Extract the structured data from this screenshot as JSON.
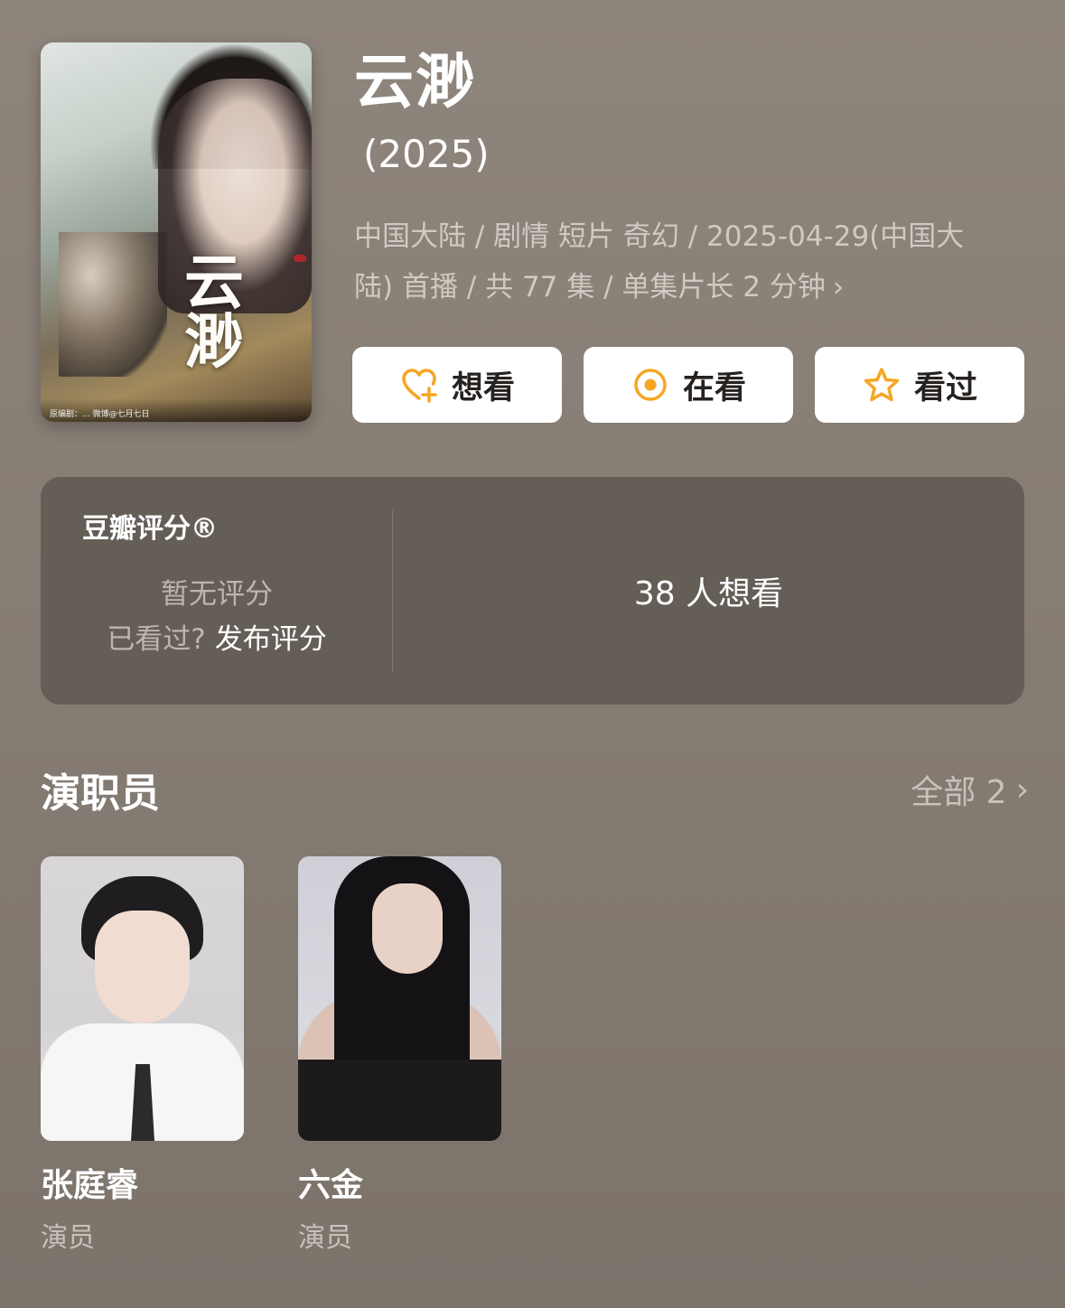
{
  "poster": {
    "title_art": "云渺",
    "credits": "原编剧：...  微博@七月七日"
  },
  "movie": {
    "title": "云渺",
    "year": "(2025)",
    "meta_line1": "中国大陆 / 剧情 短片 奇幻 / 2025-04-29(中国大",
    "meta_line2": "陆) 首播 / 共 77 集 / 单集片长 2 分钟",
    "meta_chevron": "›"
  },
  "actions": {
    "want": "想看",
    "watching": "在看",
    "watched": "看过",
    "accent_color": "#f5a623"
  },
  "rating": {
    "title": "豆瓣评分®",
    "no_rating": "暂无评分",
    "watched_question": "已看过?",
    "publish_link": "发布评分",
    "wish_count": "38 人想看"
  },
  "cast": {
    "heading": "演职员",
    "all_label": "全部 2",
    "chevron": "›",
    "members": [
      {
        "name": "张庭睿",
        "role": "演员"
      },
      {
        "name": "六金",
        "role": "演员"
      }
    ]
  }
}
